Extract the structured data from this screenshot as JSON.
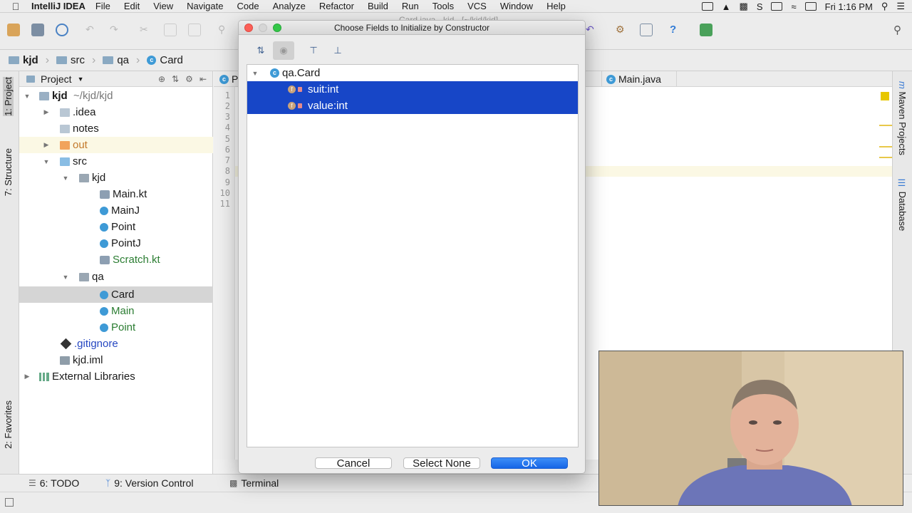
{
  "menubar": {
    "app_name": "IntelliJ IDEA",
    "items": [
      "File",
      "Edit",
      "View",
      "Navigate",
      "Code",
      "Analyze",
      "Refactor",
      "Build",
      "Run",
      "Tools",
      "VCS",
      "Window",
      "Help"
    ],
    "clock": "Fri 1:16 PM"
  },
  "window_title": "Card.java - kjd - [~/kjd/kjd]",
  "breadcrumb": [
    "kjd",
    "src",
    "qa",
    "Card"
  ],
  "project_panel": {
    "header": "Project",
    "tree": [
      {
        "label": "kjd",
        "suffix": "~/kjd/kjd"
      },
      {
        "label": ".idea"
      },
      {
        "label": "notes"
      },
      {
        "label": "out"
      },
      {
        "label": "src"
      },
      {
        "label": "kjd"
      },
      {
        "label": "Main.kt"
      },
      {
        "label": "MainJ"
      },
      {
        "label": "Point"
      },
      {
        "label": "PointJ"
      },
      {
        "label": "Scratch.kt"
      },
      {
        "label": "qa"
      },
      {
        "label": "Card"
      },
      {
        "label": "Main"
      },
      {
        "label": "Point"
      },
      {
        "label": ".gitignore"
      },
      {
        "label": "kjd.iml"
      },
      {
        "label": "External Libraries"
      }
    ]
  },
  "left_tabs": {
    "project": "1: Project",
    "structure": "7: Structure",
    "favorites": "2: Favorites"
  },
  "right_tabs": {
    "maven": "Maven Projects",
    "database": "Database"
  },
  "editor": {
    "tabs": [
      "P",
      "Main.java"
    ],
    "line_numbers": [
      "1",
      "2",
      "3",
      "4",
      "5",
      "6",
      "7",
      "8",
      "9",
      "10",
      "11"
    ]
  },
  "bottom_tools": {
    "todo": "6: TODO",
    "vcs": "9: Version Control",
    "terminal": "Terminal"
  },
  "dialog": {
    "title": "Choose Fields to Initialize by Constructor",
    "root": "qa.Card",
    "fields": [
      "suit:int",
      "value:int"
    ],
    "buttons": {
      "cancel": "Cancel",
      "select_none": "Select None",
      "ok": "OK"
    }
  },
  "colors": {
    "selection": "#1746c7",
    "accent": "#1565e6",
    "class_icon": "#3e9ad6"
  }
}
